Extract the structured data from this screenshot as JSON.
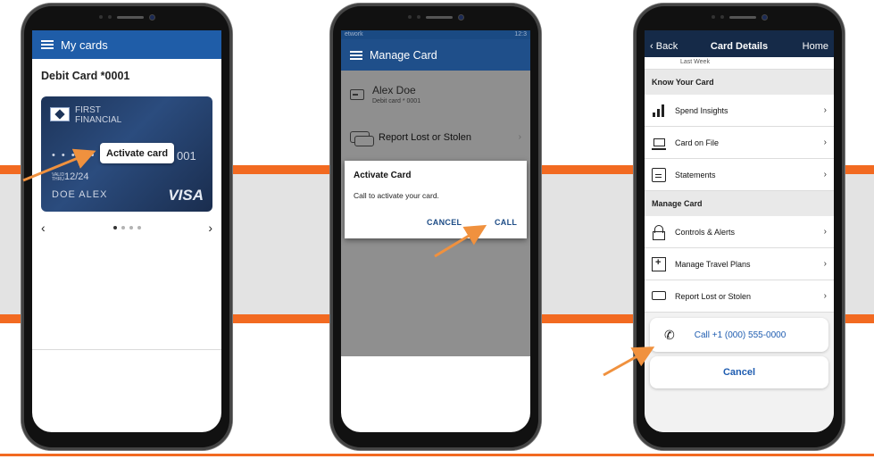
{
  "colors": {
    "brand_orange": "#f26a21",
    "appbar_blue": "#1f5da8",
    "nav_dark": "#152a48",
    "link_blue": "#1e5cb0"
  },
  "phone1": {
    "appbar_title": "My cards",
    "card_heading": "Debit Card *0001",
    "card": {
      "bank_line1": "FIRST",
      "bank_line2": "FINANCIAL",
      "masked_number": "• • • • •",
      "number_end": "001",
      "valid_label": "VALID THRU",
      "expiry": "12/24",
      "holder": "DOE ALEX",
      "network": "VISA"
    },
    "activate_label": "Activate card",
    "prev_icon": "‹",
    "next_icon": "›"
  },
  "phone2": {
    "status_left": "etwork",
    "status_right": "12:3",
    "appbar_title": "Manage Card",
    "user_name": "Alex Doe",
    "user_sub": "Debit card * 0001",
    "row_report": "Report Lost or Stolen",
    "dialog": {
      "title": "Activate Card",
      "message": "Call to activate your card.",
      "cancel": "CANCEL",
      "call": "CALL"
    }
  },
  "phone3": {
    "back": "Back",
    "title": "Card Details",
    "home": "Home",
    "last_week": "Last Week",
    "section_know": "Know Your Card",
    "items_know": [
      "Spend Insights",
      "Card on File",
      "Statements"
    ],
    "section_manage": "Manage Card",
    "items_manage": [
      "Controls & Alerts",
      "Manage Travel Plans",
      "Report Lost or Stolen"
    ],
    "call_action": "Call +1 (000) 555-0000",
    "cancel_action": "Cancel"
  }
}
